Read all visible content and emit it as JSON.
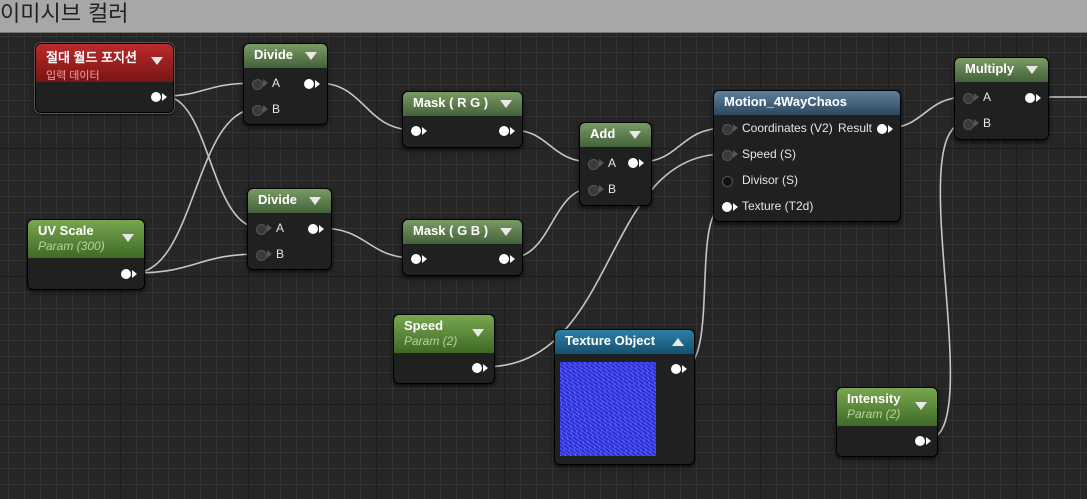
{
  "title": "이미시브 컬러",
  "nodes": {
    "absolute_world_position": {
      "title": "절대 월드 포지션",
      "subtitle": "입력 데이터"
    },
    "divide_1": {
      "title": "Divide",
      "pin_a": "A",
      "pin_b": "B"
    },
    "divide_2": {
      "title": "Divide",
      "pin_a": "A",
      "pin_b": "B"
    },
    "uv_scale": {
      "title": "UV Scale",
      "subtitle": "Param (300)"
    },
    "mask_rg": {
      "title": "Mask ( R G )"
    },
    "mask_gb": {
      "title": "Mask ( G B )"
    },
    "add": {
      "title": "Add",
      "pin_a": "A",
      "pin_b": "B"
    },
    "motion": {
      "title": "Motion_4WayChaos",
      "inputs": [
        "Coordinates (V2)",
        "Speed (S)",
        "Divisor (S)",
        "Texture (T2d)"
      ],
      "output": "Result"
    },
    "multiply": {
      "title": "Multiply",
      "pin_a": "A",
      "pin_b": "B"
    },
    "speed": {
      "title": "Speed",
      "subtitle": "Param (2)"
    },
    "texture_object": {
      "title": "Texture Object"
    },
    "intensity": {
      "title": "Intensity",
      "subtitle": "Param (2)"
    }
  },
  "colors": {
    "wire": "#d8d8d8",
    "param_header": "#5d8a3a",
    "function_header": "#3d5a74",
    "input_header": "#9a1f1f",
    "texture_header": "#1f6a8e"
  }
}
